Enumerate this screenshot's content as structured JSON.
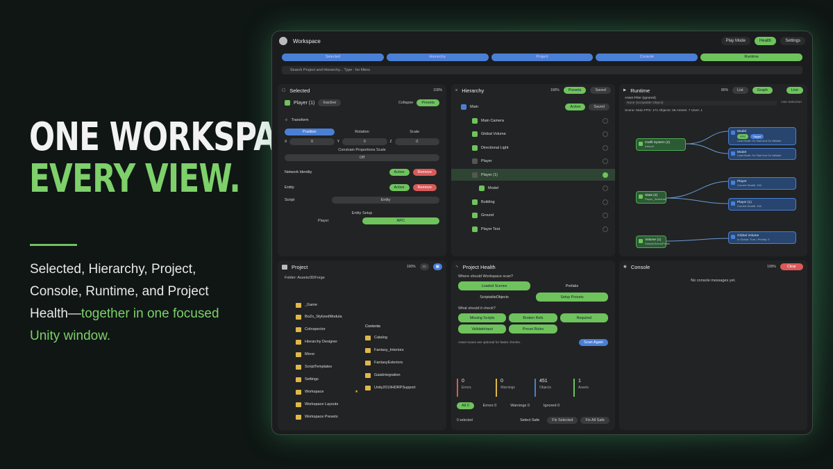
{
  "marketing": {
    "headline_line1": "ONE WORKSPACE.",
    "headline_line2": "EVERY VIEW.",
    "subtitle_plain": "Selected, Hierarchy, Project, Console, Runtime, and Project Health—",
    "subtitle_green": "together in one focused Unity window."
  },
  "window": {
    "title": "Workspace",
    "play_mode": "Play Mode",
    "health": "Health",
    "settings": "Settings",
    "tabs": [
      "Selected",
      "Hierarchy",
      "Project",
      "Console",
      "Runtime"
    ],
    "search_placeholder": "Search Project and Hierarchy... Type : for filters"
  },
  "selected": {
    "title": "Selected",
    "zoom": "100%",
    "object": "Player (1)",
    "inactive": "Inactive",
    "collapse": "Collapse",
    "presets": "Presets",
    "transform": "Transform",
    "seg": [
      "Position",
      "Rotation",
      "Scale"
    ],
    "x": "0",
    "y": "0",
    "z": "0",
    "x_label": "X",
    "y_label": "Y",
    "z_label": "Z",
    "constrain": "Constrain Proportions Scale",
    "off": "Off",
    "network_identity": "Network Identity",
    "entity": "Entity",
    "active": "Active",
    "remove": "Remove",
    "script_label": "Script",
    "script_value": "Entity",
    "entity_setup": "Entity Setup",
    "setup_opts": [
      "Player",
      "NPC"
    ]
  },
  "hierarchy": {
    "title": "Hierarchy",
    "zoom": "100%",
    "presets": "Presets",
    "saved": "Saved",
    "root": "Main",
    "active": "Active",
    "items": [
      "Main Camera",
      "Global Volume",
      "Directional Light",
      "Player",
      "Player (1)",
      "Model",
      "Building",
      "Ground",
      "Player Test"
    ]
  },
  "runtime": {
    "title": "Runtime",
    "zoom": "80%",
    "list": "List",
    "graph": "Graph",
    "live": "Live",
    "filter_label": "Asset Filter (Ignored)",
    "filter_value": "None (Scriptable Object)",
    "use_selection": "Use Selection",
    "stats": "Scene: Main   FPS: 171   Objects: 56   Assets: 7   Uses: 1",
    "fps_badge": "FPS",
    "target": "Target",
    "nodes": {
      "outfit": {
        "name": "Outfit System (2)",
        "sub": "Default"
      },
      "model1": {
        "name": "Model",
        "sub": "Load Mode: On Start And On Validate"
      },
      "model2": {
        "name": "Model",
        "sub": "Load Mode: On Start And On Validate"
      },
      "stats": {
        "name": "Stats (2)",
        "sub": "Player_StatsData"
      },
      "player1": {
        "name": "Player",
        "sub": "Current Health: 100"
      },
      "player2": {
        "name": "Player (1)",
        "sub": "Current Health: 100"
      },
      "volume": {
        "name": "Volume (1)",
        "sub": "SampleSceneProfile"
      },
      "global": {
        "name": "Global Volume",
        "sub": "Is Global: True  •  Priority: 0"
      }
    }
  },
  "project": {
    "title": "Project",
    "zoom": "100%",
    "folder": "Folder: Assets/3DForge",
    "tree": [
      "_Game",
      "BoZo_StylizedModula",
      "CoInspector",
      "Hierarchy Designer",
      "Mirror",
      "ScriptTemplates",
      "Settings",
      "Workspace",
      "Workspace Layouts",
      "Workspace Presets"
    ],
    "contents_title": "Contents",
    "contents": [
      "Catalog",
      "Fantasy_Interiors",
      "FantasyExteriors",
      "GaiaIntegration",
      "Unity2019HDRPSupport"
    ]
  },
  "health": {
    "title": "Project Health",
    "q1": "Where should Workspace scan?",
    "scan_opts": [
      "Loaded Scenes",
      "Prefabs",
      "ScriptableObjects",
      "Setup Presets"
    ],
    "q2": "What should it check?",
    "checks": [
      "Missing Scripts",
      "Broken Refs",
      "Required",
      "ValidateInput",
      "Preset Rules"
    ],
    "note": "Asset scans are optional for faster checks.",
    "scan_again": "Scan Again",
    "stats": [
      {
        "value": "0",
        "label": "Errors",
        "color": "#d95a5a"
      },
      {
        "value": "0",
        "label": "Warnings",
        "color": "#e0b84a"
      },
      {
        "value": "451",
        "label": "Objects",
        "color": "#4a7fd6"
      },
      {
        "value": "1",
        "label": "Assets",
        "color": "#6fc35c"
      }
    ],
    "filters": [
      "All  0",
      "Errors  0",
      "Warnings  0",
      "Ignored  0"
    ],
    "selected": "0 selected",
    "select_safe": "Select Safe",
    "fix_selected": "Fix Selected",
    "fix_all_safe": "Fix All Safe"
  },
  "console": {
    "title": "Console",
    "zoom": "100%",
    "clear": "Clear",
    "empty": "No console messages yet."
  }
}
